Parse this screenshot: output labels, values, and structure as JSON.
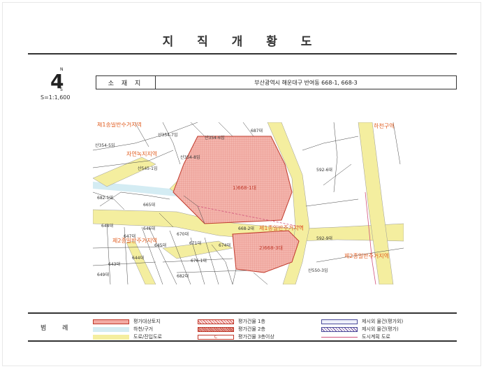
{
  "title": "지 직 개 황 도",
  "north": {
    "n": "N",
    "s": "S",
    "numeral": "4"
  },
  "scale": "S=1:1,600",
  "location": {
    "label": "소 재 지",
    "value": "부산광역시 해운대구 반여동 668-1, 668-3"
  },
  "map": {
    "zones": [
      "제1종일반주거지역",
      "자연녹지지역",
      "제1종일반주거지역",
      "제2종일반주거지역",
      "제2종일반주거지역",
      "하천구역"
    ],
    "main_parcels": [
      "1)668-1대",
      "2)668-3대"
    ],
    "parcels": [
      "산354-7임",
      "산354-5임",
      "산354-6임",
      "산354임",
      "산354-8임",
      "산545-1임",
      "산545-2임",
      "592-6대",
      "668-2대",
      "665대",
      "648대",
      "646대",
      "647대",
      "645대",
      "644대",
      "643대",
      "615대",
      "670대",
      "671대",
      "674대",
      "675대",
      "676-1대",
      "682-1대",
      "592-9대",
      "592-10대",
      "687대",
      "산550-3임",
      "682대",
      "650대",
      "641대",
      "640대",
      "649대",
      "675-1대"
    ]
  },
  "legend": {
    "label": "범 례",
    "items": [
      {
        "text": "평가대상토지",
        "kind": "target"
      },
      {
        "text": "평가건물 1층",
        "kind": "bld1"
      },
      {
        "text": "제시외 물건(평가외)",
        "kind": "excl"
      },
      {
        "text": "하천/구거",
        "kind": "river"
      },
      {
        "text": "평가건물 2층",
        "kind": "bld2"
      },
      {
        "text": "제시외 물건(평가)",
        "kind": "incl"
      },
      {
        "text": "도로/진입도로",
        "kind": "road"
      },
      {
        "text": "평가건물 3층이상",
        "kind": "bld3"
      },
      {
        "text": "도시계획 도로",
        "kind": "plan"
      }
    ]
  },
  "colors": {
    "zone_label": "#e05a1c",
    "road_fill": "#f3ed9f",
    "target_fill": "#f2aaa3",
    "river_fill": "#c8e6ef",
    "parcel_line": "#333333",
    "plan_road": "#d0507a"
  }
}
